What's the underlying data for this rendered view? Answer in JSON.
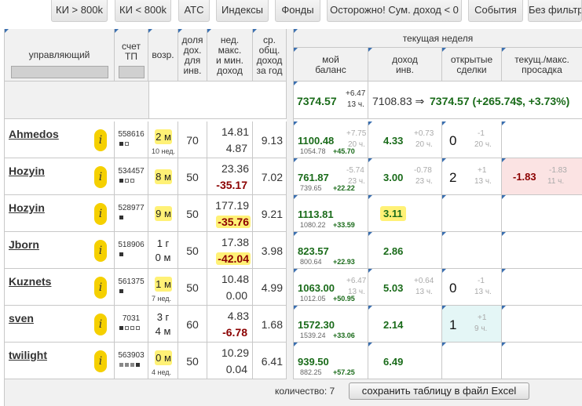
{
  "tabs": [
    "КИ > 800k",
    "КИ < 800k",
    "АТС",
    "Индексы",
    "Фонды",
    "Осторожно! Сум. доход < 0",
    "События",
    "Без фильтр"
  ],
  "headers": {
    "manager": "управляющий",
    "account": [
      "счет",
      "ТП"
    ],
    "age": "возр.",
    "share": [
      "доля",
      "дох.",
      "для",
      "инв."
    ],
    "week_max_min": [
      "нед.",
      "макс.",
      "и мин.",
      "доход"
    ],
    "avg_income": [
      "ср.",
      "общ.",
      "доход",
      "за год"
    ],
    "current_week": "текущая неделя",
    "my_balance": [
      "мой",
      "баланс"
    ],
    "income_inv": [
      "доход",
      "инв."
    ],
    "open_deals": [
      "открытые",
      "сделки"
    ],
    "drawdown": [
      "текущ./макс.",
      "просадка"
    ]
  },
  "summary": {
    "balance": "7374.57",
    "balance_delta": "+6.47",
    "balance_hours": "13 ч.",
    "change_text": "7108.83 ⇒",
    "change_result": "7374.57 (+265.74$, +3.73%)"
  },
  "rows": [
    {
      "name": "Ahmedos",
      "account": "558616",
      "sq": "fo",
      "age1": "2 м",
      "age2": "",
      "age_sub": "10 нед.",
      "age_hl": true,
      "share": "70",
      "max": "14.81",
      "min": "4.87",
      "min_red": false,
      "min_hl": false,
      "avg": "9.13",
      "bal": "1100.48",
      "bal_d": "+7.75",
      "bal_h": "20 ч.",
      "bal_prev": "1054.78",
      "bal_plus": "+45.70",
      "inc": "4.33",
      "inc_d": "+0.73",
      "inc_h": "20 ч.",
      "inc_hl": false,
      "deals": "0",
      "deals_d": "-1",
      "deals_h": "20 ч.",
      "deals_bg": "",
      "dd": "",
      "dd_d": "",
      "dd_h": ""
    },
    {
      "name": "Hozyin",
      "account": "534457",
      "sq": "foo",
      "age1": "8 м",
      "age2": "",
      "age_sub": "",
      "age_hl": true,
      "share": "50",
      "max": "23.36",
      "min": "-35.17",
      "min_red": true,
      "min_hl": false,
      "avg": "7.02",
      "bal": "761.87",
      "bal_d": "-5.74",
      "bal_h": "23 ч.",
      "bal_prev": "739.65",
      "bal_plus": "+22.22",
      "inc": "3.00",
      "inc_d": "-0.78",
      "inc_h": "23 ч.",
      "inc_hl": false,
      "deals": "2",
      "deals_d": "+1",
      "deals_h": "13 ч.",
      "deals_bg": "",
      "dd": "-1.83",
      "dd_d": "-1.83",
      "dd_h": "11 ч."
    },
    {
      "name": "Hozyin",
      "account": "528977",
      "sq": "f",
      "age1": "9 м",
      "age2": "",
      "age_sub": "",
      "age_hl": true,
      "share": "50",
      "max": "177.19",
      "min": "-35.76",
      "min_red": true,
      "min_hl": true,
      "avg": "9.21",
      "bal": "1113.81",
      "bal_d": "",
      "bal_h": "",
      "bal_prev": "1080.22",
      "bal_plus": "+33.59",
      "inc": "3.11",
      "inc_d": "",
      "inc_h": "",
      "inc_hl": true,
      "deals": "",
      "deals_d": "",
      "deals_h": "",
      "deals_bg": "",
      "dd": "",
      "dd_d": "",
      "dd_h": ""
    },
    {
      "name": "Jborn",
      "account": "518906",
      "sq": "f",
      "age1": "1 г",
      "age2": "0 м",
      "age_sub": "",
      "age_hl": false,
      "share": "50",
      "max": "17.38",
      "min": "-42.04",
      "min_red": true,
      "min_hl": true,
      "avg": "3.98",
      "bal": "823.57",
      "bal_d": "",
      "bal_h": "",
      "bal_prev": "800.64",
      "bal_plus": "+22.93",
      "inc": "2.86",
      "inc_d": "",
      "inc_h": "",
      "inc_hl": false,
      "deals": "",
      "deals_d": "",
      "deals_h": "",
      "deals_bg": "",
      "dd": "",
      "dd_d": "",
      "dd_h": ""
    },
    {
      "name": "Kuznets",
      "account": "561375",
      "sq": "f",
      "age1": "1 м",
      "age2": "",
      "age_sub": "7 нед.",
      "age_hl": true,
      "share": "50",
      "max": "10.48",
      "min": "0.00",
      "min_red": false,
      "min_hl": false,
      "avg": "4.99",
      "bal": "1063.00",
      "bal_d": "+6.47",
      "bal_h": "13 ч.",
      "bal_prev": "1012.05",
      "bal_plus": "+50.95",
      "inc": "5.03",
      "inc_d": "+0.64",
      "inc_h": "13 ч.",
      "inc_hl": false,
      "deals": "0",
      "deals_d": "-1",
      "deals_h": "13 ч.",
      "deals_bg": "",
      "dd": "",
      "dd_d": "",
      "dd_h": ""
    },
    {
      "name": "sven",
      "account": "7031",
      "sq": "fooo",
      "age1": "3 г",
      "age2": "4 м",
      "age_sub": "",
      "age_hl": false,
      "share": "60",
      "max": "4.83",
      "min": "-6.78",
      "min_red": true,
      "min_hl": false,
      "avg": "1.68",
      "bal": "1572.30",
      "bal_d": "",
      "bal_h": "",
      "bal_prev": "1539.24",
      "bal_plus": "+33.06",
      "inc": "2.14",
      "inc_d": "",
      "inc_h": "",
      "inc_hl": false,
      "deals": "1",
      "deals_d": "+1",
      "deals_h": "9 ч.",
      "deals_bg": "#e4f6f6",
      "dd": "",
      "dd_d": "",
      "dd_h": ""
    },
    {
      "name": "twilight",
      "account": "563903",
      "sq": "gggf",
      "age1": "0 м",
      "age2": "",
      "age_sub": "4 нед.",
      "age_hl": true,
      "share": "50",
      "max": "10.29",
      "min": "0.04",
      "min_red": false,
      "min_hl": false,
      "avg": "6.41",
      "bal": "939.50",
      "bal_d": "",
      "bal_h": "",
      "bal_prev": "882.25",
      "bal_plus": "+57.25",
      "inc": "6.49",
      "inc_d": "",
      "inc_h": "",
      "inc_hl": false,
      "deals": "",
      "deals_d": "",
      "deals_h": "",
      "deals_bg": "",
      "dd": "",
      "dd_d": "",
      "dd_h": ""
    }
  ],
  "footer": {
    "count_label": "количество: 7",
    "excel_button": "сохранить таблицу в файл Excel"
  }
}
